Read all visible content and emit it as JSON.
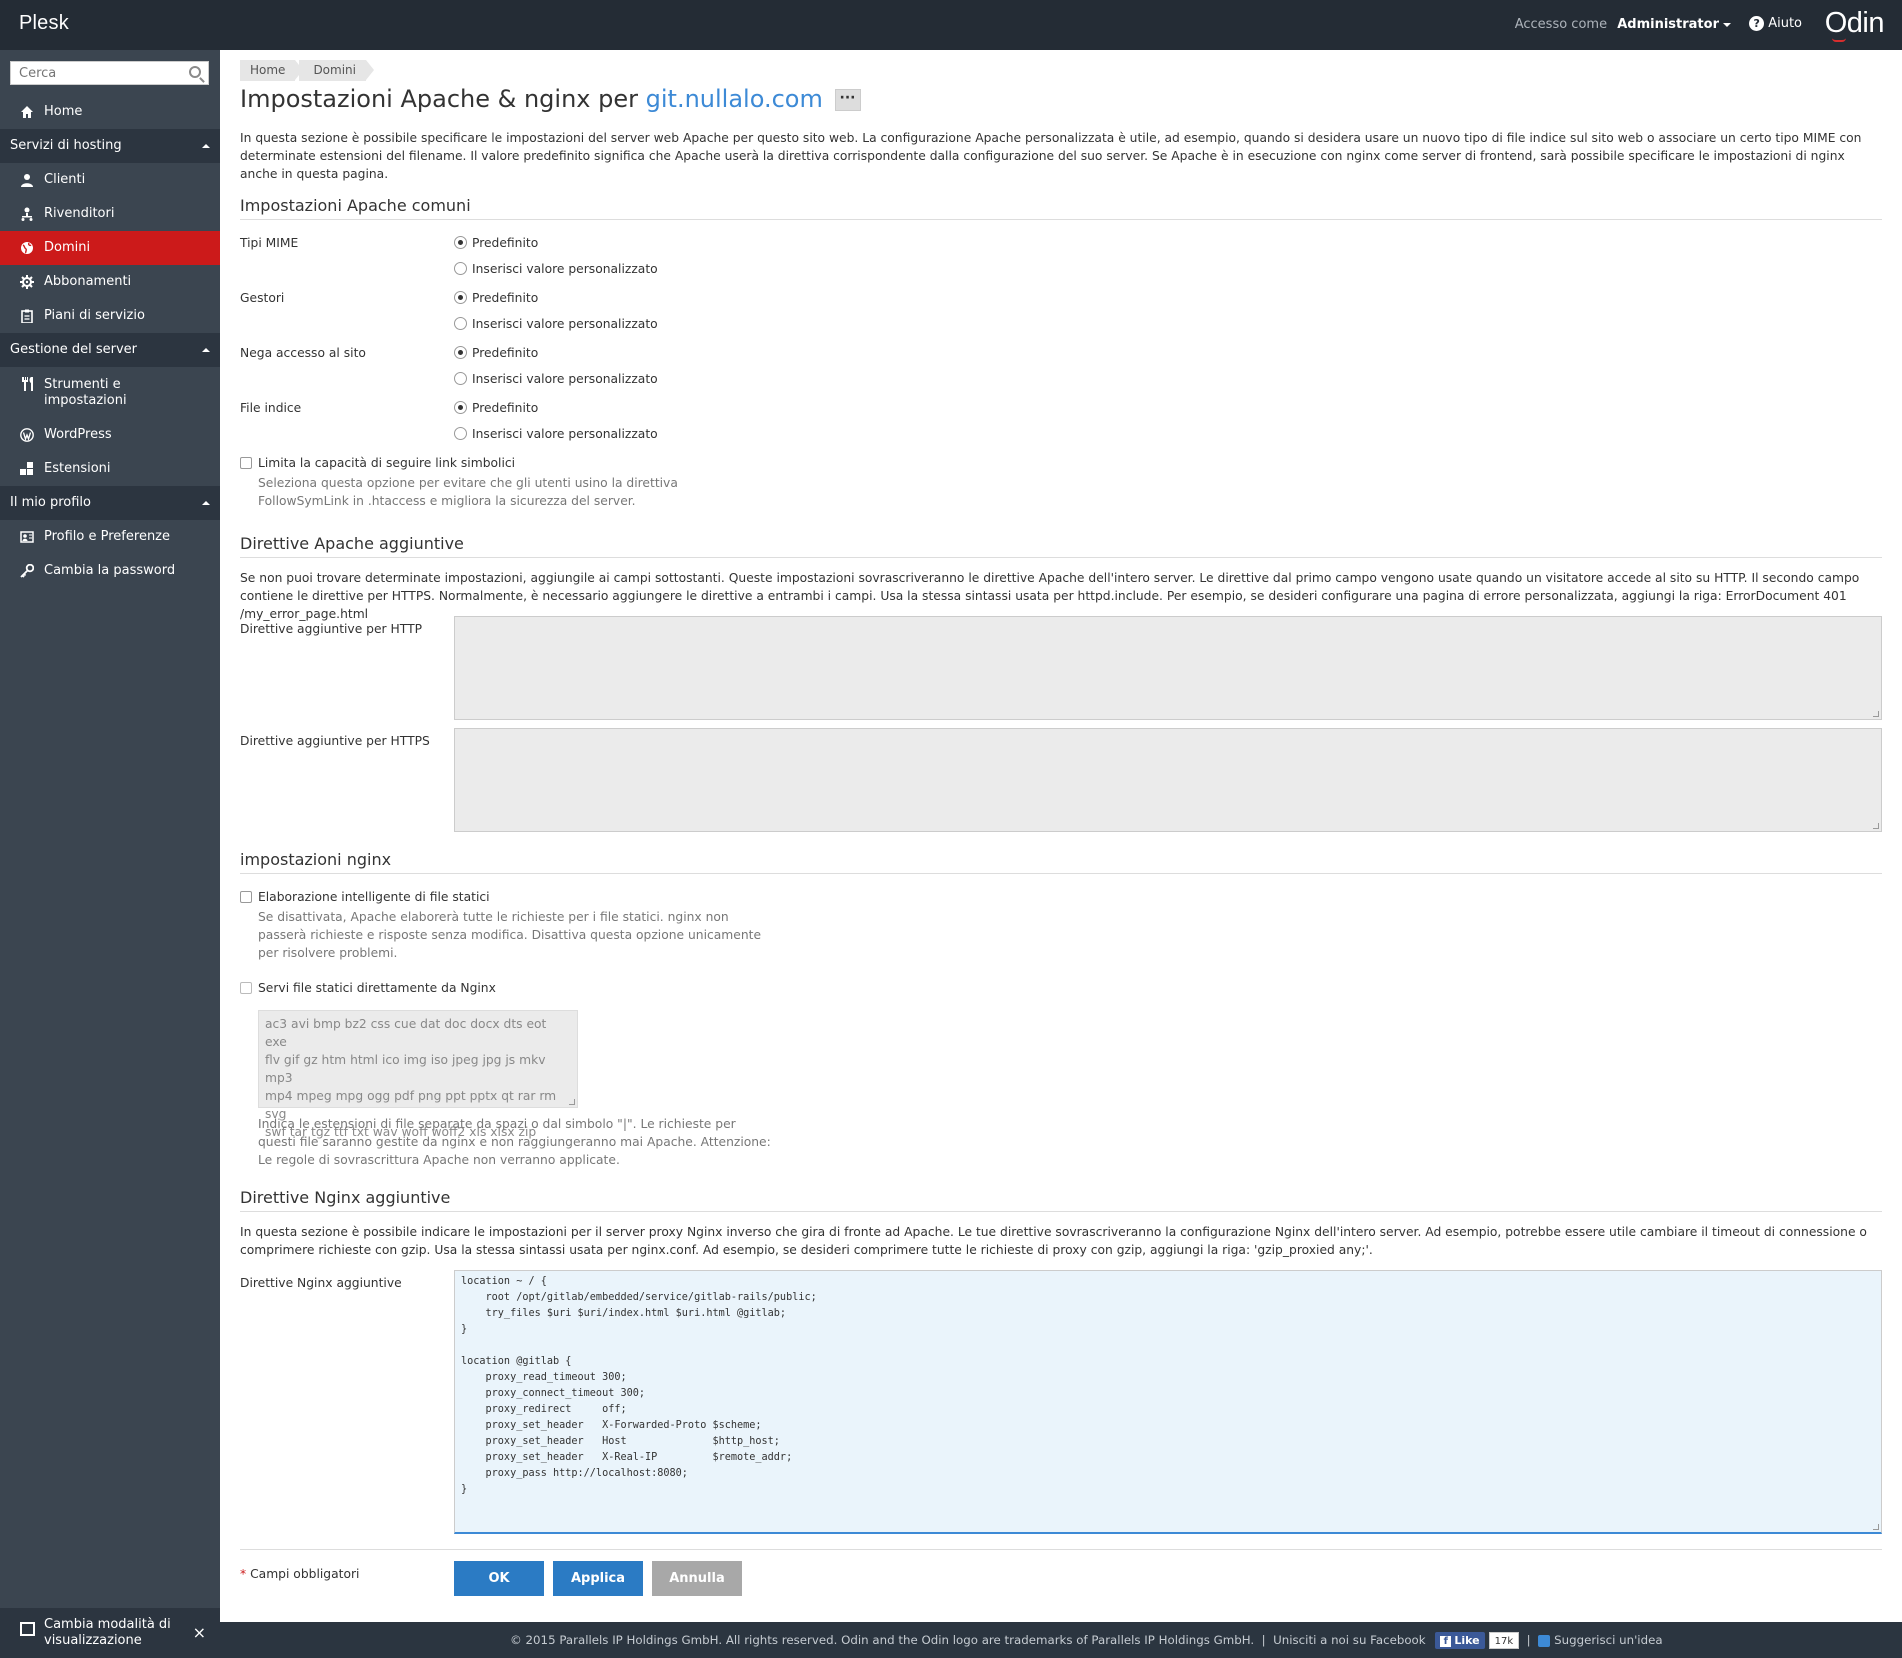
{
  "topbar": {
    "brand": "Plesk",
    "access_label": "Accesso come",
    "user": "Administrator",
    "help": "Aiuto",
    "vendor_logo": "Odin"
  },
  "sidebar": {
    "search_placeholder": "Cerca",
    "home": "Home",
    "sections": [
      {
        "label": "Servizi di hosting",
        "items": [
          "Clienti",
          "Rivenditori",
          "Domini",
          "Abbonamenti",
          "Piani di servizio"
        ]
      },
      {
        "label": "Gestione del server",
        "items": [
          "Strumenti e impostazioni",
          "WordPress",
          "Estensioni"
        ]
      },
      {
        "label": "Il mio profilo",
        "items": [
          "Profilo e Preferenze",
          "Cambia la password"
        ]
      }
    ],
    "active_item": "Domini",
    "bottom": "Cambia modalità di visualizzazione",
    "icons": [
      "home-icon",
      "user-icon",
      "resellers-icon",
      "globe-icon",
      "gear-icon",
      "clipboard-icon",
      "tools-icon",
      "wordpress-icon",
      "extensions-icon",
      "profile-icon",
      "key-icon",
      "view-mode-icon"
    ]
  },
  "breadcrumb": [
    "Home",
    "Domini"
  ],
  "title": {
    "prefix": "Impostazioni Apache & nginx per",
    "domain": "git.nullalo.com",
    "more": "···"
  },
  "intro": "In questa sezione è possibile specificare le impostazioni del server web Apache per questo sito web. La configurazione Apache personalizzata è utile, ad esempio, quando si desidera usare un nuovo tipo di file indice sul sito web o associare un certo tipo MIME con determinate estensioni del filename. Il valore predefinito significa che Apache userà la direttiva corrispondente dalla configurazione del suo server. Se Apache è in esecuzione con nginx come server di frontend, sarà possibile specificare le impostazioni di nginx anche in questa pagina.",
  "apache_common": {
    "title": "Impostazioni Apache comuni",
    "options": {
      "default": "Predefinito",
      "custom": "Inserisci valore personalizzato"
    },
    "fields": [
      {
        "label": "Tipi MIME",
        "selected": "default"
      },
      {
        "label": "Gestori",
        "selected": "default"
      },
      {
        "label": "Nega accesso al sito",
        "selected": "default"
      },
      {
        "label": "File indice",
        "selected": "default"
      }
    ],
    "symlink": {
      "label": "Limita la capacità di seguire link simbolici",
      "hint_1": "Seleziona questa opzione per evitare che gli utenti usino la direttiva",
      "hint_2": "FollowSymLink in .htaccess e migliora la sicurezza del server.",
      "checked": false
    }
  },
  "apache_extra": {
    "title": "Direttive Apache aggiuntive",
    "desc": "Se non puoi trovare determinate impostazioni, aggiungile ai campi sottostanti. Queste impostazioni sovrascriveranno le direttive Apache dell'intero server. Le direttive dal primo campo vengono usate quando un visitatore accede al sito su HTTP. Il secondo campo contiene le direttive per HTTPS. Normalmente, è necessario aggiungere le direttive a entrambi i campi. Usa la stessa sintassi usata per httpd.include. Per esempio, se desideri configurare una pagina di errore personalizzata, aggiungi la riga: ErrorDocument 401 /my_error_page.html",
    "http_label": "Direttive aggiuntive per HTTP",
    "https_label": "Direttive aggiuntive per HTTPS",
    "http_value": "",
    "https_value": ""
  },
  "nginx": {
    "title": "impostazioni nginx",
    "smart_static": {
      "label": "Elaborazione intelligente di file statici",
      "hint_1": "Se disattivata, Apache elaborerà tutte le richieste per i file statici. nginx non",
      "hint_2": "passerà richieste e risposte senza modifica. Disattiva questa opzione unicamente",
      "hint_3": "per risolvere problemi.",
      "checked": false
    },
    "serve_static": {
      "label": "Servi file statici direttamente da Nginx",
      "checked": false,
      "extensions_1": "ac3 avi bmp bz2 css cue dat doc docx dts eot exe",
      "extensions_2": "flv gif gz htm html ico img iso jpeg jpg js mkv mp3",
      "extensions_3": "mp4 mpeg mpg ogg pdf png ppt pptx qt rar rm svg",
      "extensions_4": "swf tar tgz ttf txt wav woff woff2 xls xlsx zip",
      "hint_1": "Indica le estensioni di file separate da spazi o dal simbolo \"|\". Le richieste per",
      "hint_2": "questi file saranno gestite da nginx e non raggiungeranno mai Apache. Attenzione:",
      "hint_3": "Le regole di sovrascrittura Apache non verranno applicate."
    }
  },
  "nginx_extra": {
    "title": "Direttive Nginx aggiuntive",
    "desc": "In questa sezione è possibile indicare le impostazioni per il server proxy Nginx inverso che gira di fronte ad Apache. Le tue direttive sovrascriveranno la configurazione Nginx dell'intero server. Ad esempio, potrebbe essere utile cambiare il timeout di connessione o comprimere richieste con gzip. Usa la stessa sintassi usata per nginx.conf. Ad esempio, se desideri comprimere tutte le richieste di proxy con gzip, aggiungi la riga: 'gzip_proxied any;'.",
    "label": "Direttive Nginx aggiuntive",
    "value": "location ~ / {\n    root /opt/gitlab/embedded/service/gitlab-rails/public;\n    try_files $uri $uri/index.html $uri.html @gitlab;\n}\n\nlocation @gitlab {\n    proxy_read_timeout 300;\n    proxy_connect_timeout 300;\n    proxy_redirect     off;\n    proxy_set_header   X-Forwarded-Proto $scheme;\n    proxy_set_header   Host              $http_host;\n    proxy_set_header   X-Real-IP         $remote_addr;\n    proxy_pass http://localhost:8080;\n}"
  },
  "form": {
    "required_star": "*",
    "required_label": "Campi obbligatori",
    "ok": "OK",
    "apply": "Applica",
    "cancel": "Annulla"
  },
  "footer": {
    "copyright": "© 2015 Parallels IP Holdings GmbH. All rights reserved. Odin and the Odin logo are trademarks of Parallels IP Holdings GmbH.",
    "sep": "|",
    "facebook": "Unisciti a noi su Facebook",
    "like": "Like",
    "like_f": "f",
    "like_count": "17k",
    "idea": "Suggerisci un'idea"
  },
  "colors": {
    "topbar": "#242c35",
    "sidebar": "#3b4550",
    "active": "#cc1a1a",
    "link": "#3d8ad6",
    "primary_button": "#2b7bc4"
  }
}
